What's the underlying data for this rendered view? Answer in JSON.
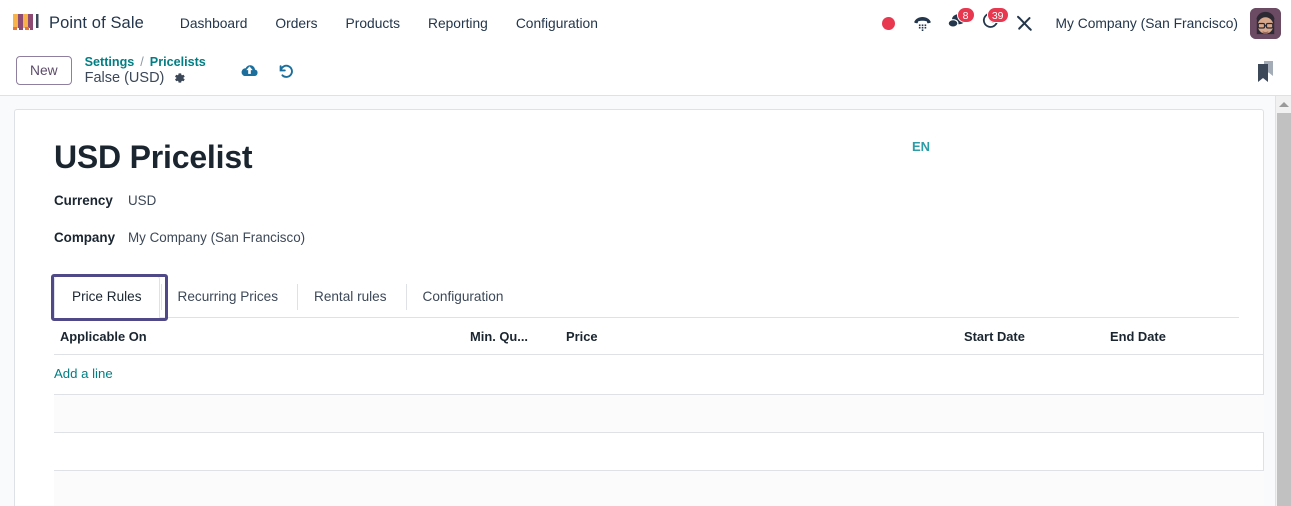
{
  "navbar": {
    "brand": "Point of Sale",
    "brand_logo_icon": "shop-awning-icon",
    "menu_items": [
      {
        "label": "Dashboard"
      },
      {
        "label": "Orders"
      },
      {
        "label": "Products"
      },
      {
        "label": "Reporting"
      },
      {
        "label": "Configuration"
      }
    ],
    "systray": {
      "recording_icon": "record-dot-icon",
      "dialpad_icon": "phone-dialpad-icon",
      "messages_icon": "chat-bubble-icon",
      "messages_count": "8",
      "activities_icon": "clock-activity-icon",
      "activities_count": "39",
      "tools_icon": "wrench-screwdriver-icon",
      "company": "My Company (San Francisco)",
      "avatar_icon": "user-avatar"
    }
  },
  "control_panel": {
    "new_button": "New",
    "breadcrumb": {
      "parent": "Settings",
      "separator": "/",
      "section": "Pricelists",
      "record": "False (USD)"
    },
    "settings_cog_icon": "gear-icon",
    "save_icon": "cloud-upload-icon",
    "discard_icon": "undo-arrow-icon",
    "bookmark_icon": "bookmark-icon"
  },
  "form": {
    "language_badge": "EN",
    "title": "USD Pricelist",
    "fields": [
      {
        "label": "Currency",
        "value": "USD"
      },
      {
        "label": "Company",
        "value": "My Company (San Francisco)"
      }
    ]
  },
  "notebook": {
    "tabs": [
      {
        "label": "Price Rules",
        "active": true
      },
      {
        "label": "Recurring Prices",
        "active": false
      },
      {
        "label": "Rental rules",
        "active": false
      },
      {
        "label": "Configuration",
        "active": false
      }
    ]
  },
  "price_rules_list": {
    "columns": [
      "Applicable On",
      "Min. Qu...",
      "Price",
      "Start Date",
      "End Date"
    ],
    "rows": [],
    "add_line_label": "Add a line",
    "empty_filler_rows": 3
  },
  "colors": {
    "accent_teal": "#017E84",
    "brand_purple": "#5C4B6B",
    "focus_purple": "#4F4A87",
    "badge_red": "#E8384F",
    "text_dark": "#1A2530",
    "border": "#DEE2E6",
    "page_bg": "#F9FAFB"
  }
}
